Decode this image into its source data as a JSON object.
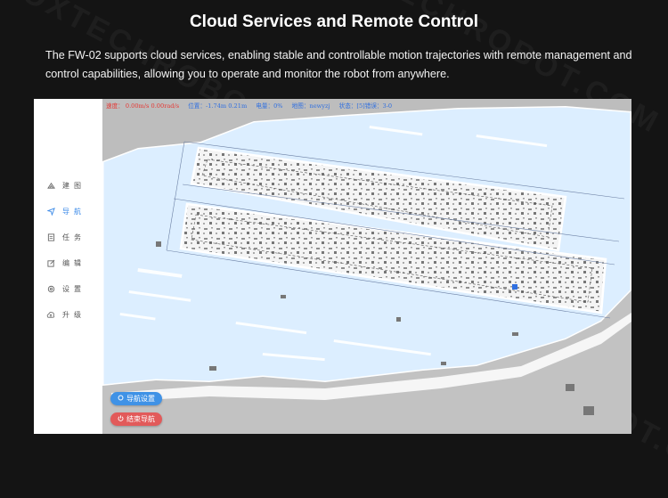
{
  "hero": {
    "title": "Cloud Services and Remote Control",
    "description": "The FW-02 supports cloud services, enabling stable and controllable motion trajectories with remote management and control capabilities, allowing you to operate and monitor the robot from anywhere."
  },
  "watermark": "FOXTECHROBOT.COM",
  "sidebar": {
    "items": [
      {
        "icon": "map-build-icon",
        "label": "建图",
        "active": false
      },
      {
        "icon": "navigation-icon",
        "label": "导航",
        "active": true
      },
      {
        "icon": "task-icon",
        "label": "任务",
        "active": false
      },
      {
        "icon": "edit-icon",
        "label": "编辑",
        "active": false
      },
      {
        "icon": "settings-icon",
        "label": "设置",
        "active": false
      },
      {
        "icon": "upgrade-icon",
        "label": "升级",
        "active": false
      }
    ]
  },
  "status": {
    "speed": "速度： 0.00m/s    0.00rad/s",
    "position": "位置：-1.74m   0.21m",
    "battery": "电量：0%",
    "map": "地图：newyzj",
    "state": "状态：[5]错误：3-0"
  },
  "buttons": {
    "nav_settings": "导航设置",
    "end_nav": "结束导航"
  },
  "colors": {
    "accent": "#3f92e6",
    "danger": "#e25a5a",
    "status_red": "#e53935",
    "status_blue": "#2f6fe0",
    "free_space": "#dceeff"
  }
}
